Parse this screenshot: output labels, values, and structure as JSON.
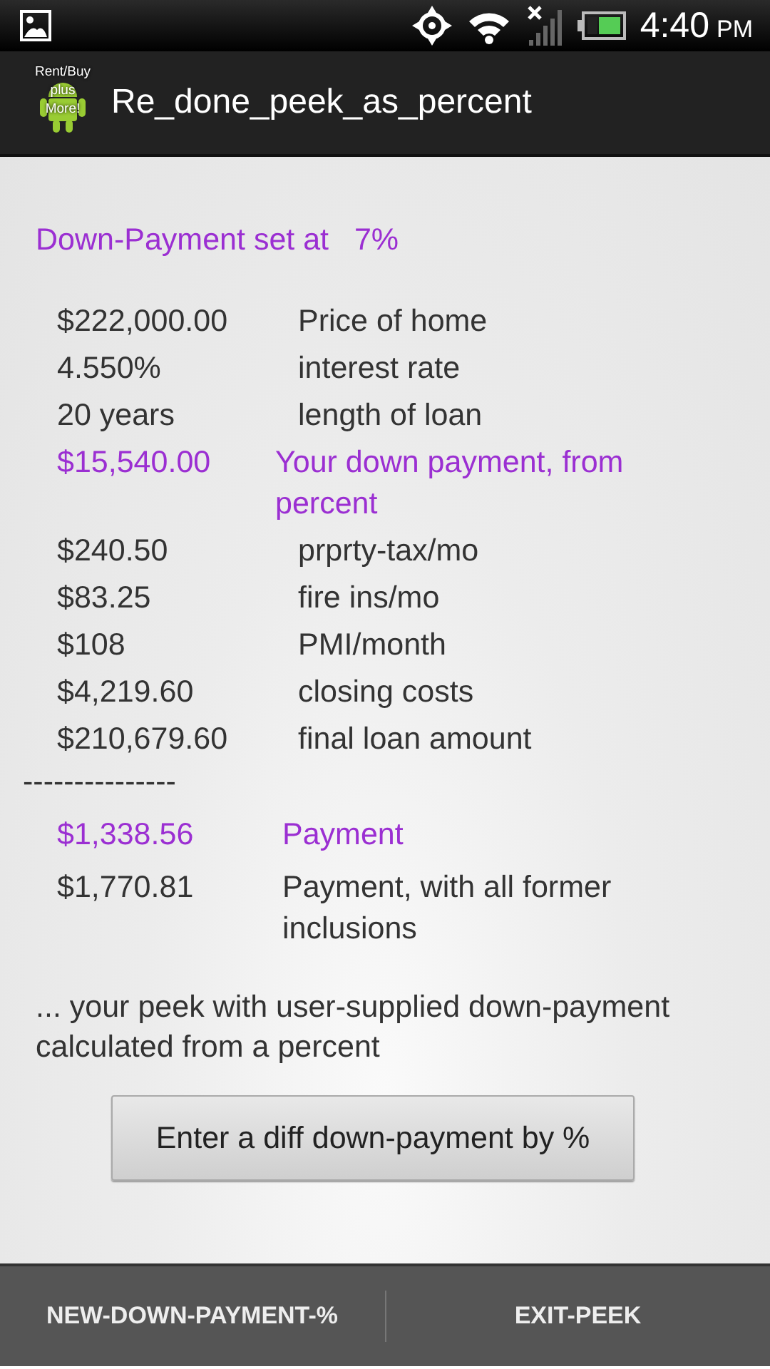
{
  "status_bar": {
    "time": "4:40",
    "ampm": "PM"
  },
  "app_bar": {
    "icon_text": [
      "Rent/Buy",
      "plus",
      "More!"
    ],
    "title": "Re_done_peek_as_percent"
  },
  "heading": "Down-Payment set at   7%",
  "rows": [
    {
      "value": "$222,000.00",
      "label": "Price of home",
      "highlight": false
    },
    {
      "value": "4.550%",
      "label": "interest rate",
      "highlight": false
    },
    {
      "value": "20 years",
      "label": "length of loan",
      "highlight": false
    },
    {
      "value": "$15,540.00",
      "label": "Your down payment, from percent",
      "highlight": true
    },
    {
      "value": "$240.50",
      "label": "prprty-tax/mo",
      "highlight": false
    },
    {
      "value": "$83.25",
      "label": "fire ins/mo",
      "highlight": false
    },
    {
      "value": "$108",
      "label": "PMI/month",
      "highlight": false
    },
    {
      "value": "$4,219.60",
      "label": "closing costs",
      "highlight": false
    },
    {
      "value": "$210,679.60",
      "label": "final loan amount",
      "highlight": false
    }
  ],
  "separator": "---------------",
  "payments": [
    {
      "value": "$1,338.56",
      "label": "Payment",
      "highlight": true
    },
    {
      "value": "$1,770.81",
      "label": "Payment, with all former inclusions",
      "highlight": false
    }
  ],
  "note": "... your peek with user-supplied down-payment calculated from a percent",
  "button": "Enter a diff down-payment by %",
  "bottom_actions": [
    "NEW-DOWN-PAYMENT-%",
    "EXIT-PEEK"
  ]
}
